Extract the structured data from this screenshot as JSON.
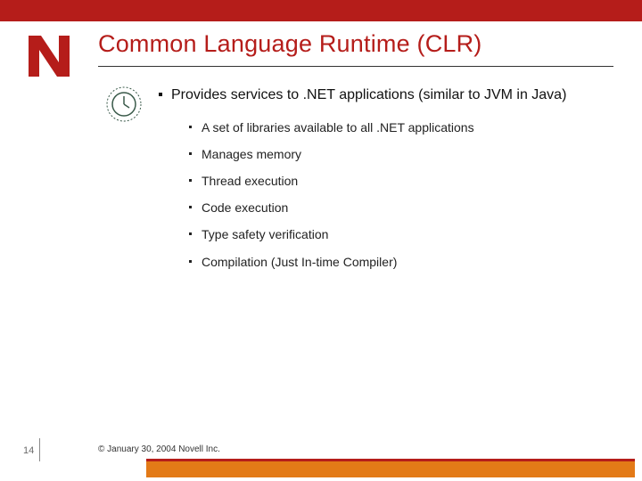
{
  "colors": {
    "brand_red": "#b51d1a",
    "accent_orange": "#e37a17"
  },
  "logo_letter": "N",
  "title": "Common Language Runtime (CLR)",
  "bullets": {
    "level1": "Provides services to .NET applications (similar to JVM in Java)",
    "level2": [
      "A set of libraries available to all .NET applications",
      "Manages memory",
      "Thread execution",
      "Code execution",
      "Type safety verification",
      "Compilation (Just In-time Compiler)"
    ]
  },
  "page_number": "14",
  "copyright": "© January 30, 2004 Novell Inc."
}
